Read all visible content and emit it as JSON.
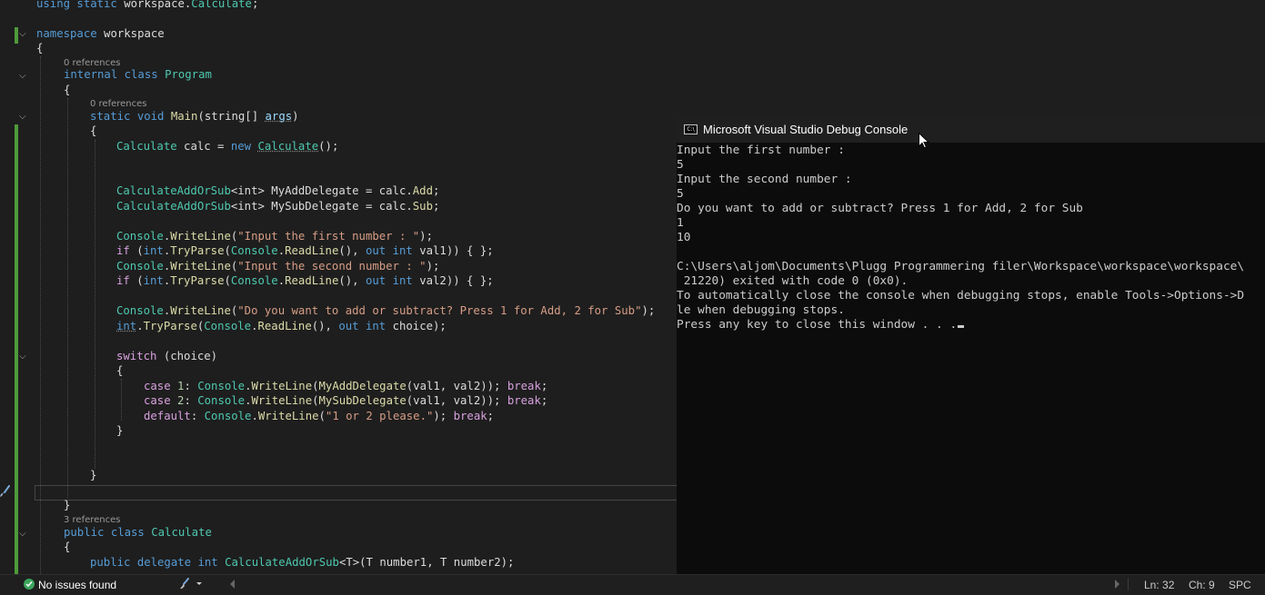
{
  "code": {
    "using_kw": "using static",
    "using_ns": "workspace.",
    "using_type": "Calculate",
    "using_end": ";",
    "ns_kw": "namespace",
    "ns_name": "workspace",
    "brace_open": "{",
    "brace_close": "}",
    "refs_program": "0 references",
    "class_mod": "internal class",
    "class_name": "Program",
    "refs_main": "0 references",
    "main_mod": "static void",
    "main_name": "Main",
    "main_params_a": "(string[] ",
    "main_params_b": "args",
    "main_params_c": ")",
    "l_calc_type": "Calculate",
    "l_calc_var": " calc = ",
    "l_calc_new": "new",
    "l_calc_ctor": "Calculate",
    "l_calc_end": "();",
    "l_add_type": "CalculateAddOrSub",
    "l_add_gen": "<int>",
    "l_add_var": " MyAddDelegate = calc.",
    "l_add_m": "Add",
    "l_add_end": ";",
    "l_sub_type": "CalculateAddOrSub",
    "l_sub_gen": "<int>",
    "l_sub_var": " MySubDelegate = calc.",
    "l_sub_m": "Sub",
    "l_sub_end": ";",
    "console": "Console",
    "writeline": "WriteLine",
    "readline": "ReadLine",
    "tryparse": "TryParse",
    "int_kw": "int",
    "if_kw": "if",
    "out_int": "out int",
    "str_first": "\"Input the first number : \"",
    "str_second": "\"Input the second number : \"",
    "str_question": "\"Do you want to add or subtract? Press 1 for Add, 2 for Sub\"",
    "val1_end": " val1)) { };",
    "val2_end": " val2)) { };",
    "choice_end": " choice);",
    "switch_kw": "switch",
    "switch_arg": " (choice)",
    "case_kw": "case",
    "case1_num": " 1",
    "case2_num": " 2",
    "add_call": "MyAddDelegate",
    "sub_call": "MySubDelegate",
    "call_args": "(val1, val2)); ",
    "break_kw": "break",
    "default_kw": "default",
    "str_please": "\"1 or 2 please.\"",
    "refs_calculate": "3 references",
    "pub_class": "public class",
    "calc_class": "Calculate",
    "deleg_mod": "public delegate int",
    "deleg_name": "CalculateAddOrSub",
    "deleg_gen": "<T>",
    "deleg_params": "(T number1, T number2);"
  },
  "console": {
    "title": "Microsoft Visual Studio Debug Console",
    "icon_text": "C:\\",
    "lines": [
      "Input the first number :",
      "5",
      "Input the second number :",
      "5",
      "Do you want to add or subtract? Press 1 for Add, 2 for Sub",
      "1",
      "10",
      "",
      "C:\\Users\\aljom\\Documents\\Plugg Programmering filer\\Workspace\\workspace\\workspace\\",
      " 21220) exited with code 0 (0x0).",
      "To automatically close the console when debugging stops, enable Tools->Options->D",
      "le when debugging stops.",
      "Press any key to close this window . . ."
    ]
  },
  "status": {
    "issues": "No issues found",
    "ln": "Ln: 32",
    "ch": "Ch: 9",
    "enc": "SPC"
  },
  "colors": {
    "keyword": "#569cd6",
    "type": "#4ec9b0",
    "method": "#dcdcaa",
    "string": "#d69d85",
    "control": "#d8a0df",
    "git_added": "#4e9a3a",
    "ok": "#3ba55d"
  }
}
